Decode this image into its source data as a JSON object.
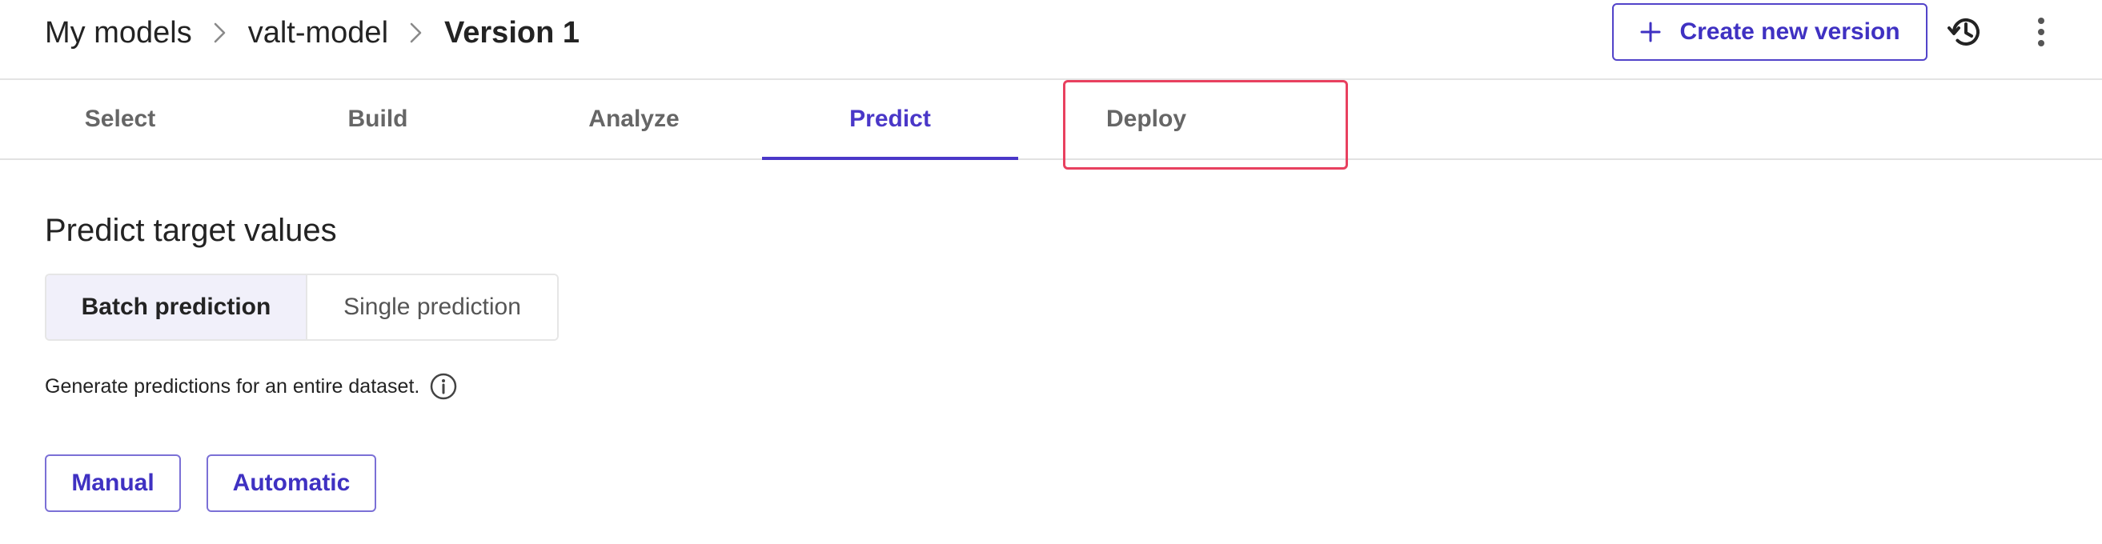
{
  "breadcrumb": {
    "items": [
      "My models",
      "valt-model",
      "Version 1"
    ]
  },
  "header": {
    "create_label": "Create new version"
  },
  "icons": {
    "chevron": "chevron-right-icon",
    "plus": "plus-icon",
    "history": "history-icon",
    "more": "more-vertical-icon",
    "info": "info-icon"
  },
  "tabs": [
    {
      "label": "Select"
    },
    {
      "label": "Build"
    },
    {
      "label": "Analyze"
    },
    {
      "label": "Predict",
      "active": true
    },
    {
      "label": "Deploy"
    }
  ],
  "main": {
    "title": "Predict target values",
    "segments": [
      {
        "label": "Batch prediction",
        "selected": true
      },
      {
        "label": "Single prediction"
      }
    ],
    "description": "Generate predictions for an entire dataset.",
    "manual_label": "Manual",
    "automatic_label": "Automatic"
  },
  "colors": {
    "accent": "#4a37c8",
    "highlight": "#e8405f",
    "selected_bg": "#f1f0fa"
  }
}
